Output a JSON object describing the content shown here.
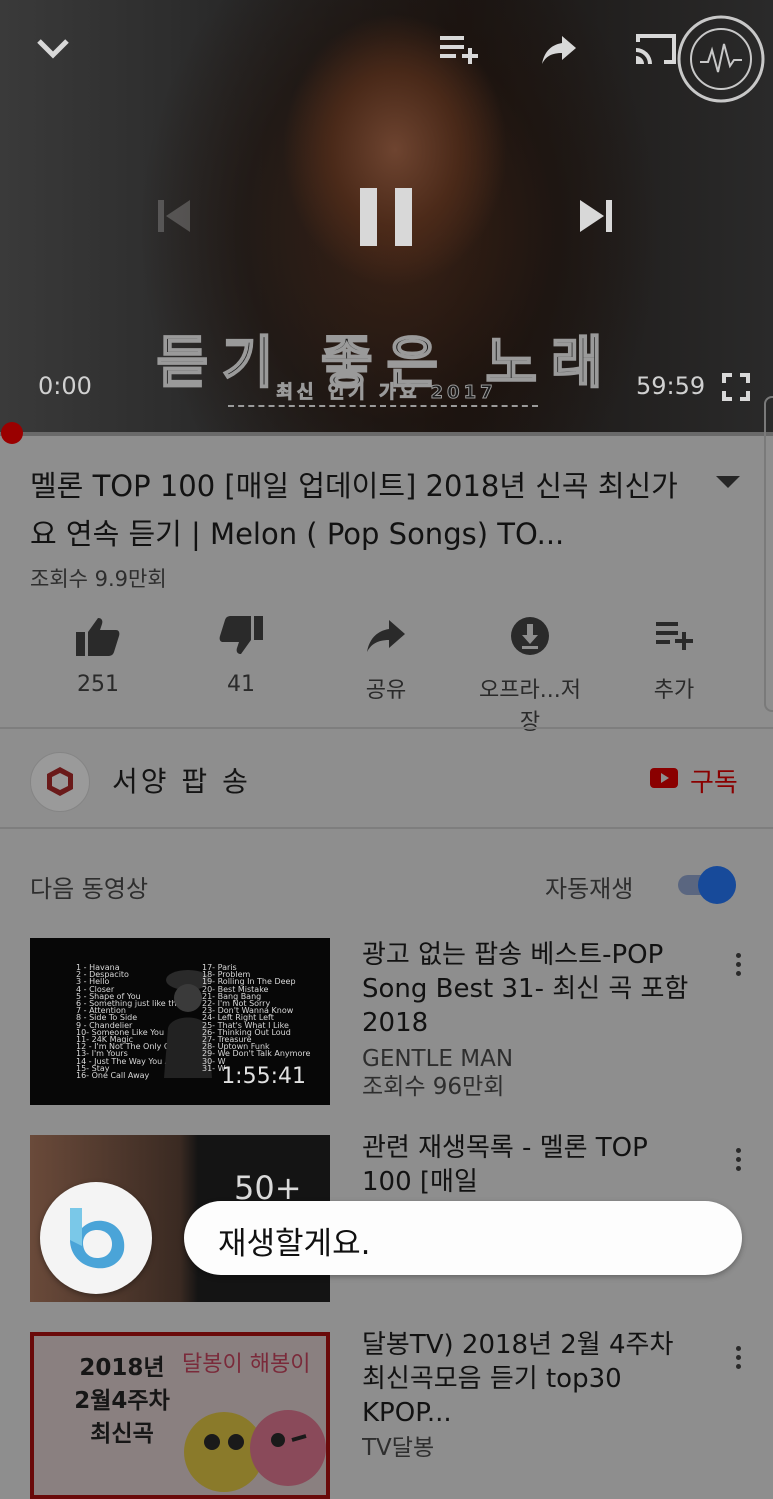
{
  "player": {
    "overlay_title": "듣기 좋은 노래",
    "overlay_subtitle": "최신 인기 가요 2017",
    "current_time": "0:00",
    "total_time": "59:59",
    "progress": 0.0,
    "icons": [
      "chevron-down-icon",
      "add-to-queue-icon",
      "share-icon",
      "cast-icon",
      "previous-icon",
      "pause-icon",
      "next-icon",
      "fullscreen-icon"
    ]
  },
  "video": {
    "title": "멜론 TOP 100 [매일 업데이트] 2018년 신곡 최신가요 연속 듣기 | Melon ( Pop Songs) TO...",
    "views": "조회수 9.9만회"
  },
  "actions": {
    "like_count": "251",
    "dislike_count": "41",
    "share_label": "공유",
    "save_offline_label": "오프라...저장",
    "add_label": "추가"
  },
  "channel": {
    "name": "서양 팝 송",
    "subscribe_label": "구독"
  },
  "upnext": {
    "label": "다음 동영상",
    "autoplay_label": "자동재생",
    "autoplay_on": true
  },
  "videos": [
    {
      "title": "광고 없는 팝송 베스트-POP Song Best 31- 최신 곡 포함 2018",
      "channel": "GENTLE MAN",
      "views": "조회수 96만회",
      "duration": "1:55:41",
      "tracklist_left": "1 - Havana\n2 - Despacito\n3 - Hello\n4 - Closer\n5 - Shape of You\n6 - Something just like this\n7 - Attention\n8 - Side To Side\n9 - Chandelier\n10- Someone Like You\n11- 24K Magic\n12 - I'm Not The Only One\n13- I'm Yours\n14 - Just The Way You Are\n15- Stay\n16- One Call Away",
      "tracklist_right": "17- Paris\n18- Problem\n19- Rolling In The Deep\n20- Best Mistake\n21- Bang Bang\n22- I'm Not Sorry\n23- Don't Wanna Know\n24- Left Right Left\n25- That's What I Like\n26- Thinking Out Loud\n27- Treasure\n28- Uptown Funk\n29- We Don't Talk Anymore\n30- W\n31- W"
    },
    {
      "title": "관련 재생목록 - 멜론 TOP 100 [매일",
      "count": "50+"
    },
    {
      "title": "달봉TV) 2018년 2월 4주차 최신곡모음 듣기 top30 KPOP...",
      "channel": "TV달봉",
      "thumb_text": "2018년\n2월4주차\n최신곡",
      "thumb_tag": "달봉이 해봉이"
    }
  ],
  "bixby": {
    "message": "재생할게요."
  }
}
